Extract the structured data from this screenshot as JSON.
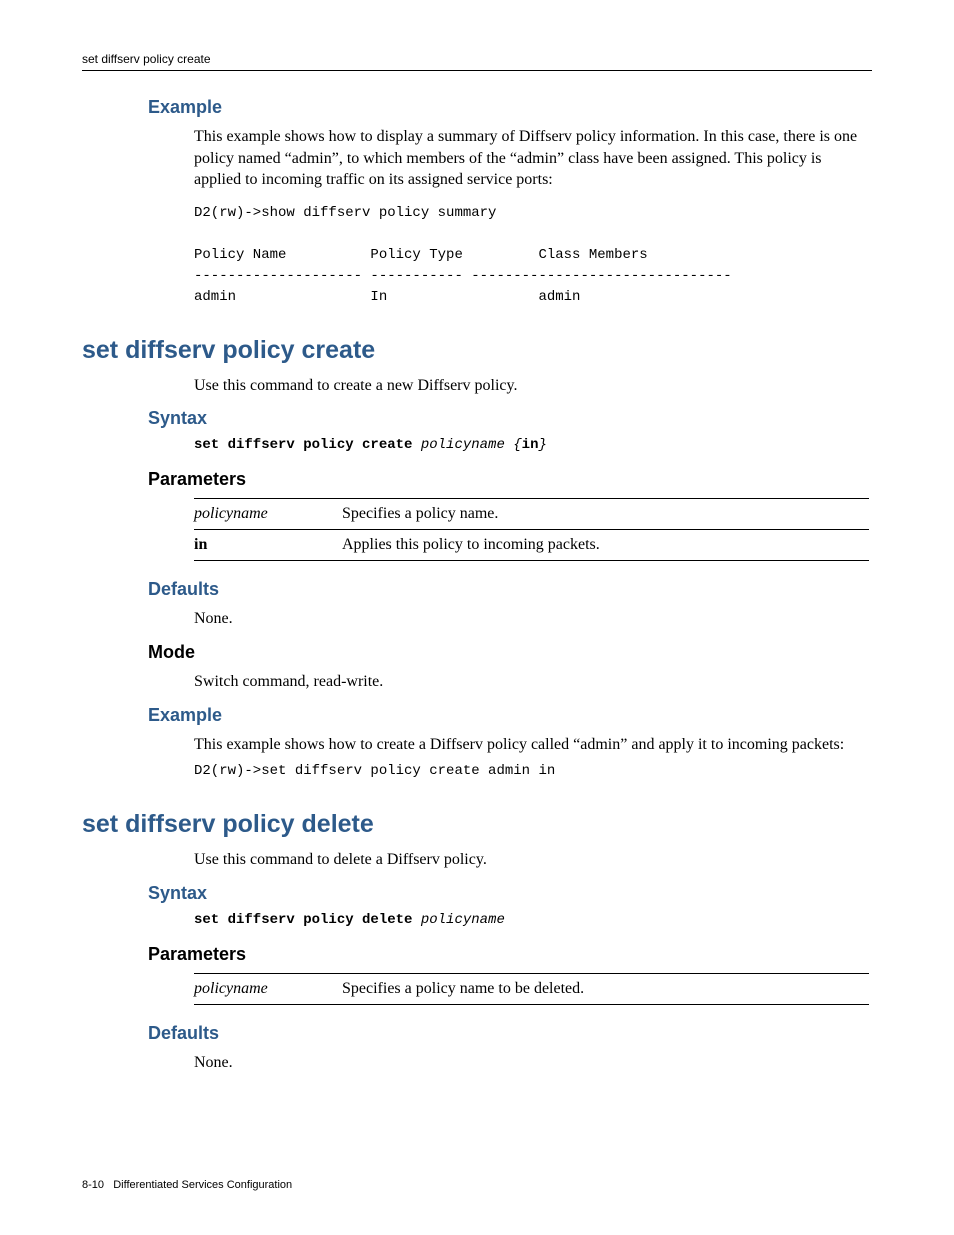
{
  "header": {
    "running": "set diffserv policy create"
  },
  "sec1": {
    "example_h": "Example",
    "example_p": "This example shows how to display a summary of Diffserv policy information. In this case, there is one policy named “admin”, to which members of the “admin” class have been assigned. This policy is applied to incoming traffic on its assigned service ports:",
    "code": "D2(rw)->show diffserv policy summary\n\nPolicy Name          Policy Type         Class Members\n-------------------- ----------- -------------------------------\nadmin                In                  admin"
  },
  "sec2": {
    "title": "set diffserv policy create",
    "intro": "Use this command to create a new Diffserv policy.",
    "syntax_h": "Syntax",
    "syntax_cmd": "set diffserv policy create",
    "syntax_arg": "policyname",
    "syntax_brace_open": "{",
    "syntax_kw": "in",
    "syntax_brace_close": "}",
    "params_h": "Parameters",
    "params": [
      {
        "name": "policyname",
        "italic": true,
        "desc": "Specifies a policy name."
      },
      {
        "name": "in",
        "italic": false,
        "desc": "Applies this policy to incoming packets."
      }
    ],
    "defaults_h": "Defaults",
    "defaults_v": "None.",
    "mode_h": "Mode",
    "mode_v": "Switch command, read‐write.",
    "example_h": "Example",
    "example_p": "This example shows how to create a Diffserv policy called “admin” and apply it to incoming packets:",
    "code": "D2(rw)->set diffserv policy create admin in"
  },
  "sec3": {
    "title": "set diffserv policy delete",
    "intro": "Use this command to delete a Diffserv policy.",
    "syntax_h": "Syntax",
    "syntax_cmd": "set diffserv policy delete",
    "syntax_arg": "policyname",
    "params_h": "Parameters",
    "params": [
      {
        "name": "policyname",
        "italic": true,
        "desc": "Specifies a policy name to be deleted."
      }
    ],
    "defaults_h": "Defaults",
    "defaults_v": "None."
  },
  "footer": {
    "page": "8-10",
    "chapter": "Differentiated Services Configuration"
  }
}
